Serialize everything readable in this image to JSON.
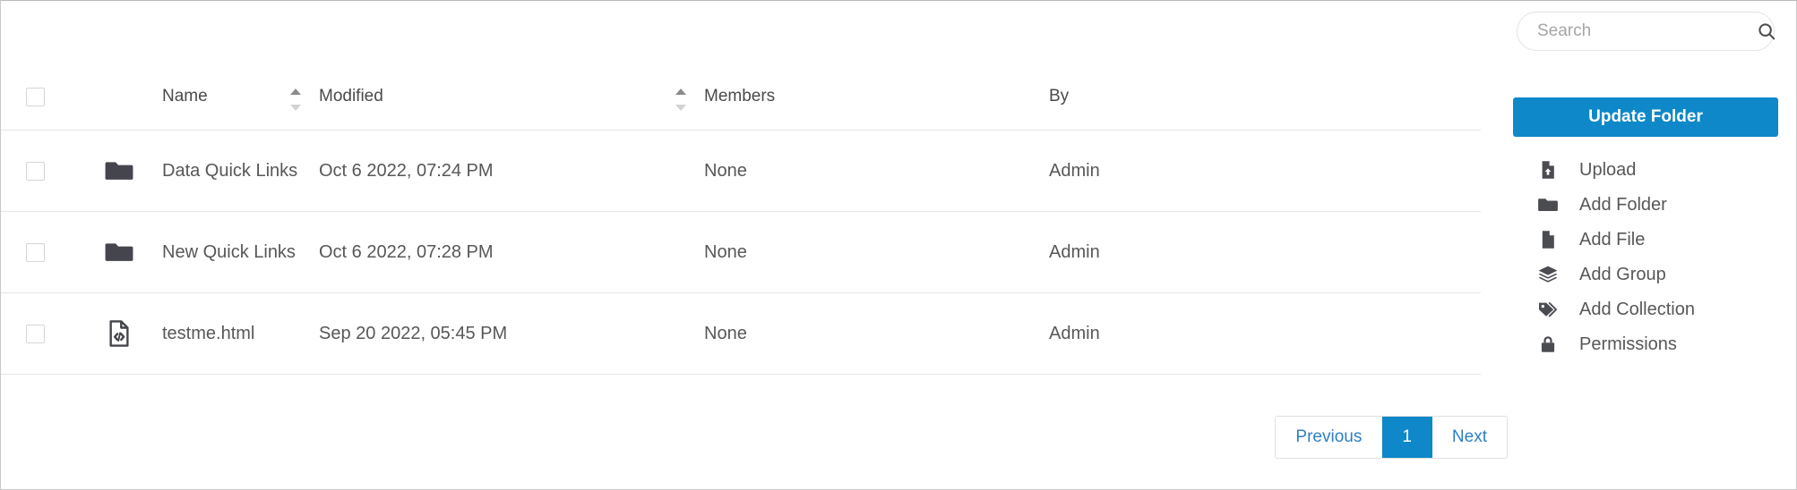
{
  "search": {
    "placeholder": "Search",
    "value": "",
    "icon": "search-icon"
  },
  "table": {
    "columns": [
      {
        "key": "check",
        "label": "",
        "sortable": false
      },
      {
        "key": "icon",
        "label": "",
        "sortable": false
      },
      {
        "key": "name",
        "label": "Name",
        "sortable": true
      },
      {
        "key": "modified",
        "label": "Modified",
        "sortable": true
      },
      {
        "key": "members",
        "label": "Members",
        "sortable": false
      },
      {
        "key": "by",
        "label": "By",
        "sortable": false
      }
    ],
    "rows": [
      {
        "icon": "folder-icon",
        "name": "Data Quick Links",
        "modified": "Oct 6 2022, 07:24 PM",
        "members": "None",
        "by": "Admin"
      },
      {
        "icon": "folder-icon",
        "name": "New Quick Links",
        "modified": "Oct 6 2022, 07:28 PM",
        "members": "None",
        "by": "Admin"
      },
      {
        "icon": "code-file-icon",
        "name": "testme.html",
        "modified": "Sep 20 2022, 05:45 PM",
        "members": "None",
        "by": "Admin"
      }
    ]
  },
  "pagination": {
    "previous_label": "Previous",
    "next_label": "Next",
    "pages": [
      "1"
    ],
    "current_page": "1"
  },
  "sidebar": {
    "primary_button": {
      "label": "Update Folder",
      "color": "#0e88c8"
    },
    "actions": [
      {
        "label": "Upload",
        "icon": "file-upload-icon"
      },
      {
        "label": "Add Folder",
        "icon": "folder-icon"
      },
      {
        "label": "Add File",
        "icon": "file-icon"
      },
      {
        "label": "Add Group",
        "icon": "layers-icon"
      },
      {
        "label": "Add Collection",
        "icon": "tags-icon"
      },
      {
        "label": "Permissions",
        "icon": "lock-icon"
      }
    ]
  },
  "colors": {
    "accent": "#0e88c8",
    "link": "#2f7fc4",
    "text": "#575757",
    "icon": "#45464d",
    "border": "#e6e6e6"
  }
}
